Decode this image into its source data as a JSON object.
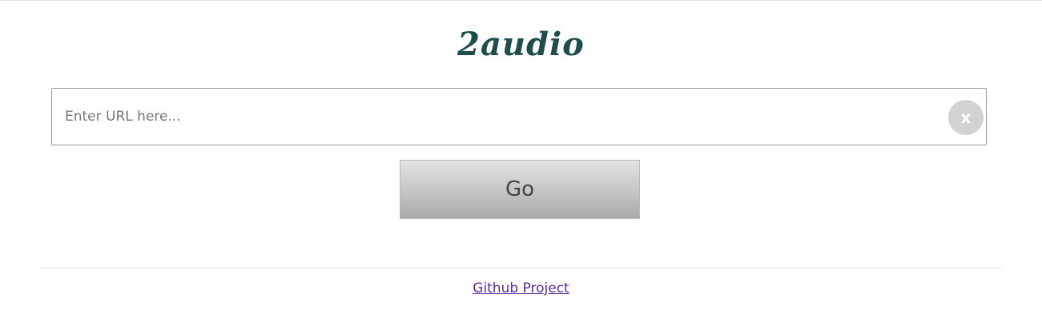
{
  "app": {
    "logo_text": "2audio"
  },
  "url_form": {
    "placeholder": "Enter URL here...",
    "value": "",
    "clear_label": "x",
    "submit_label": "Go"
  },
  "footer": {
    "link_text": "Github Project"
  },
  "colors": {
    "logo": "#1f4d4c",
    "link": "#5b2b9b",
    "clear_button": "#d2d2d2"
  },
  "icons": {
    "clear": "close-icon"
  }
}
